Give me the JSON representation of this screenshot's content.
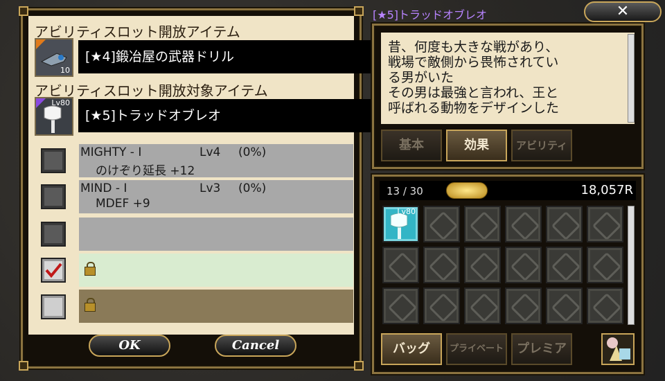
{
  "left_panel": {
    "unlock_item_header": "アビリティスロット開放アイテム",
    "unlock_item": {
      "name": "[★4]鍛冶屋の武器ドリル",
      "count": "10",
      "icon": "drill-icon"
    },
    "target_item_header": "アビリティスロット開放対象アイテム",
    "target_item": {
      "name": "[★5]トラッドオブレオ",
      "level": "Lv80",
      "icon": "axe-icon"
    },
    "slots": [
      {
        "name": "MIGHTY - I",
        "level": "Lv4",
        "percent": "(0%)",
        "effect": "のけぞり延長 +12",
        "checked": false,
        "locked": false
      },
      {
        "name": "MIND - I",
        "level": "Lv3",
        "percent": "(0%)",
        "effect": "MDEF +9",
        "checked": false,
        "locked": false
      },
      {
        "name": "",
        "level": "",
        "percent": "",
        "effect": "",
        "checked": false,
        "locked": false
      },
      {
        "name": "",
        "checked": true,
        "locked": true
      },
      {
        "name": "",
        "checked": false,
        "locked": true
      }
    ],
    "ok_label": "OK",
    "cancel_label": "Cancel"
  },
  "detail_panel": {
    "title": "[★5]トラッドオブレオ",
    "close_label": "✕",
    "description_lines": [
      "昔、何度も大きな戦があり、",
      "戦場で敵側から畏怖されてい",
      "る男がいた",
      "その男は最強と言われ、王と",
      "呼ばれる動物をデザインした"
    ],
    "tabs": [
      "基本",
      "効果",
      "アビリティ"
    ],
    "active_tab": 1
  },
  "inventory": {
    "count": "13 / 30",
    "money": "18,057R",
    "first_item_level": "Lv80",
    "tabs": [
      "バッグ",
      "プライベート",
      "プレミア"
    ],
    "active_tab": 0,
    "colors": {
      "accent_gold": "#c9a65a",
      "title_purple": "#b884ff",
      "active_slot": "#33b5c6"
    }
  }
}
